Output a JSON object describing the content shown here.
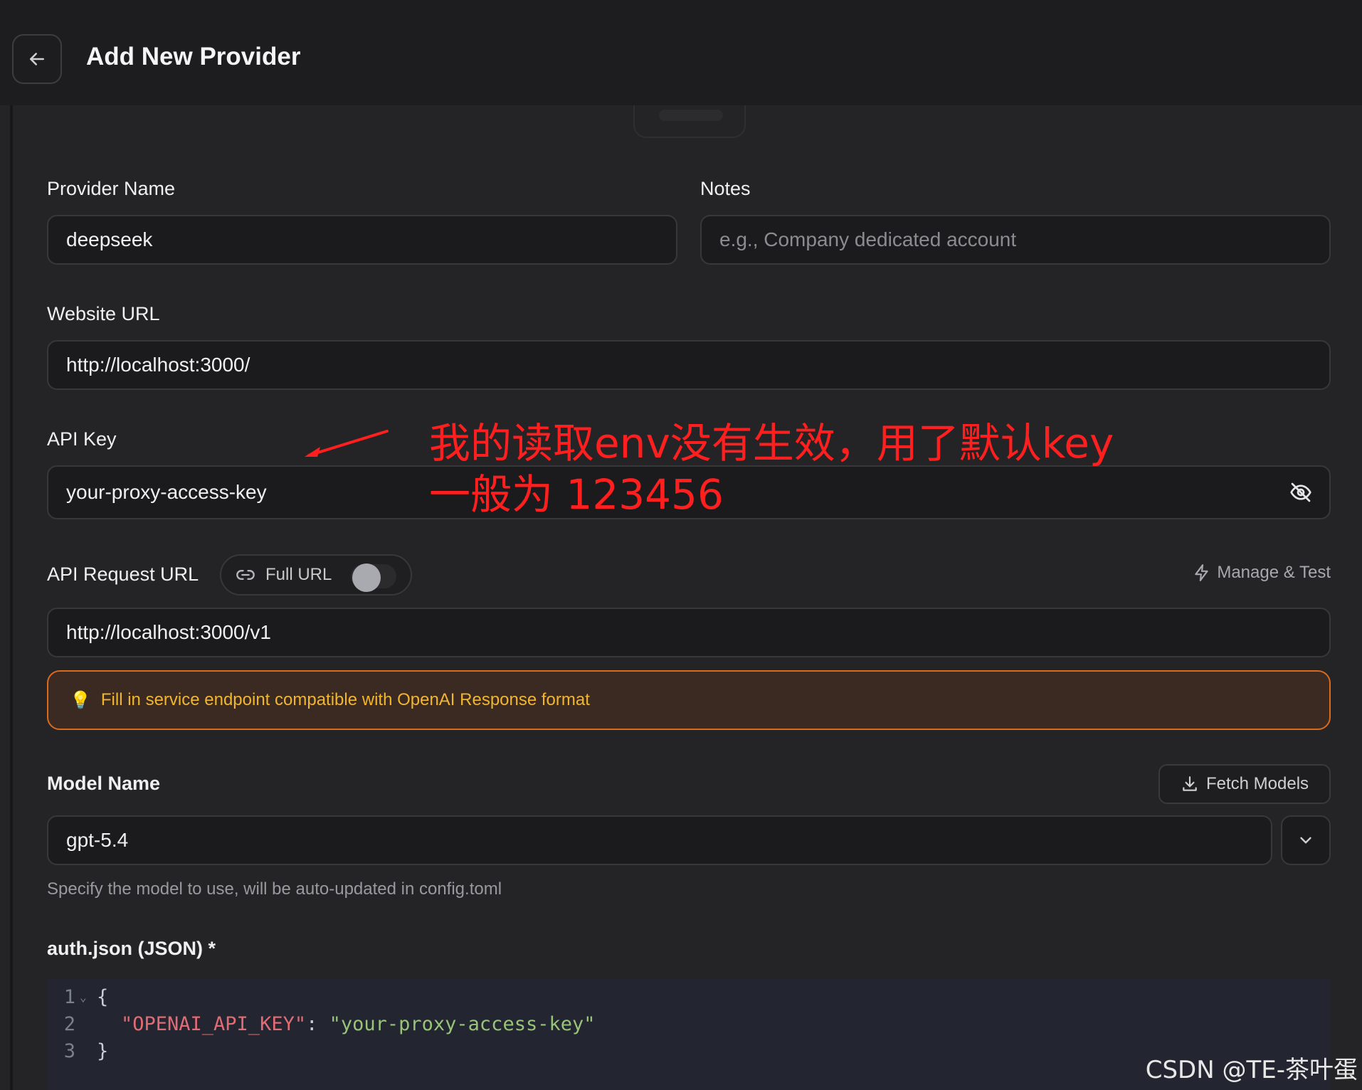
{
  "header": {
    "title": "Add New Provider"
  },
  "form": {
    "provider_name": {
      "label": "Provider Name",
      "value": "deepseek"
    },
    "notes": {
      "label": "Notes",
      "placeholder": "e.g., Company dedicated account"
    },
    "website_url": {
      "label": "Website URL",
      "value": "http://localhost:3000/"
    },
    "api_key": {
      "label": "API Key",
      "value": "your-proxy-access-key"
    },
    "api_request_url": {
      "label": "API Request URL",
      "full_url_toggle_label": "Full URL",
      "full_url_enabled": false,
      "manage_test_label": "Manage & Test",
      "value": "http://localhost:3000/v1"
    },
    "hint": {
      "text": "Fill in service endpoint compatible with OpenAI Response format"
    },
    "model_name": {
      "label": "Model Name",
      "fetch_button": "Fetch Models",
      "value": "gpt-5.4",
      "helper": "Specify the model to use, will be auto-updated in config.toml"
    },
    "auth_json": {
      "label": "auth.json (JSON) *",
      "lines": [
        {
          "num": "1",
          "open": "{"
        },
        {
          "num": "2",
          "key": "\"OPENAI_API_KEY\"",
          "colon": ": ",
          "value": "\"your-proxy-access-key\""
        },
        {
          "num": "3",
          "close": "}"
        }
      ]
    }
  },
  "annotation": {
    "line1": "我的读取env没有生效，用了默认key",
    "line2": "一般为 123456"
  },
  "watermark": "CSDN @TE-茶叶蛋",
  "colors": {
    "background": "#242426",
    "header": "#1d1d1f",
    "field_bg": "#1b1b1d",
    "hint_border": "#d96b1f",
    "hint_text": "#f2b52e",
    "annotation": "#ff1f1f"
  }
}
